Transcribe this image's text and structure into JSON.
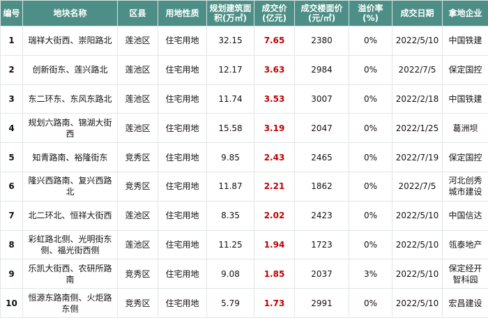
{
  "table": {
    "headers": [
      "编号",
      "地块名称",
      "区县",
      "用地性质",
      "规划建筑面积(万㎡)",
      "成交价(亿元)",
      "成交楼面价(元/㎡)",
      "溢价率(%)",
      "成交日期",
      "拿地企业"
    ],
    "rows": [
      [
        "1",
        "瑞祥大街西、崇阳路北",
        "莲池区",
        "住宅用地",
        "32.15",
        "7.65",
        "2380",
        "0%",
        "2022/5/10",
        "中国铁建"
      ],
      [
        "2",
        "创新街东、莲兴路北",
        "莲池区",
        "住宅用地",
        "12.17",
        "3.63",
        "2984",
        "0%",
        "2022/7/5",
        "保定国控"
      ],
      [
        "3",
        "东二环东、东风东路北",
        "莲池区",
        "住宅用地",
        "11.74",
        "3.53",
        "3007",
        "0%",
        "2022/2/18",
        "中国铁建"
      ],
      [
        "4",
        "规划六路南、锦湖大街西",
        "莲池区",
        "住宅用地",
        "15.58",
        "3.19",
        "2047",
        "0%",
        "2022/1/25",
        "葛洲坝"
      ],
      [
        "5",
        "知青路南、裕隆街东",
        "竞秀区",
        "住宅用地",
        "9.85",
        "2.43",
        "2465",
        "0%",
        "2022/7/19",
        "保定国控"
      ],
      [
        "6",
        "隆兴西路南、复兴西路北",
        "竞秀区",
        "住宅用地",
        "11.87",
        "2.21",
        "1862",
        "0%",
        "2022/7/5",
        "河北创秀城市建设"
      ],
      [
        "7",
        "北二环北、恒祥大街西",
        "莲池区",
        "住宅用地",
        "8.35",
        "2.02",
        "2423",
        "0%",
        "2022/5/10",
        "中国信达"
      ],
      [
        "8",
        "彩虹路北侧、光明街东侧、福光街西侧",
        "莲池区",
        "住宅用地",
        "11.25",
        "1.94",
        "1723",
        "0%",
        "2022/5/10",
        "瓴泰地产"
      ],
      [
        "9",
        "乐凯大街西、农研所路南",
        "竞秀区",
        "住宅用地",
        "9.08",
        "1.85",
        "2037",
        "3%",
        "2022/5/10",
        "保定经开智科园"
      ],
      [
        "10",
        "恒源东路南侧、火炬路东侧",
        "竞秀区",
        "住宅用地",
        "5.79",
        "1.73",
        "2991",
        "0%",
        "2022/5/10",
        "宏昌建设"
      ]
    ]
  }
}
